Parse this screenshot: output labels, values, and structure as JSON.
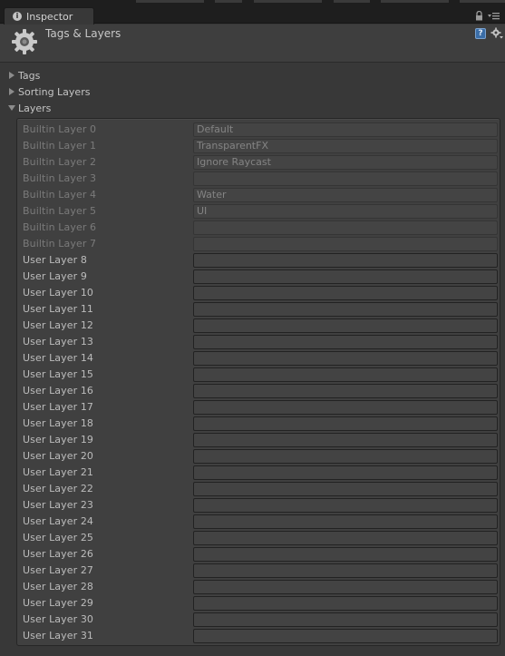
{
  "tab": {
    "label": "Inspector"
  },
  "header": {
    "title": "Tags & Layers"
  },
  "sections": [
    {
      "label": "Tags",
      "expanded": false
    },
    {
      "label": "Sorting Layers",
      "expanded": false
    },
    {
      "label": "Layers",
      "expanded": true
    }
  ],
  "layers": [
    {
      "label": "Builtin Layer 0",
      "value": "Default",
      "builtin": true
    },
    {
      "label": "Builtin Layer 1",
      "value": "TransparentFX",
      "builtin": true
    },
    {
      "label": "Builtin Layer 2",
      "value": "Ignore Raycast",
      "builtin": true
    },
    {
      "label": "Builtin Layer 3",
      "value": "",
      "builtin": true
    },
    {
      "label": "Builtin Layer 4",
      "value": "Water",
      "builtin": true
    },
    {
      "label": "Builtin Layer 5",
      "value": "UI",
      "builtin": true
    },
    {
      "label": "Builtin Layer 6",
      "value": "",
      "builtin": true
    },
    {
      "label": "Builtin Layer 7",
      "value": "",
      "builtin": true
    },
    {
      "label": "User Layer 8",
      "value": "",
      "builtin": false
    },
    {
      "label": "User Layer 9",
      "value": "",
      "builtin": false
    },
    {
      "label": "User Layer 10",
      "value": "",
      "builtin": false
    },
    {
      "label": "User Layer 11",
      "value": "",
      "builtin": false
    },
    {
      "label": "User Layer 12",
      "value": "",
      "builtin": false
    },
    {
      "label": "User Layer 13",
      "value": "",
      "builtin": false
    },
    {
      "label": "User Layer 14",
      "value": "",
      "builtin": false
    },
    {
      "label": "User Layer 15",
      "value": "",
      "builtin": false
    },
    {
      "label": "User Layer 16",
      "value": "",
      "builtin": false
    },
    {
      "label": "User Layer 17",
      "value": "",
      "builtin": false
    },
    {
      "label": "User Layer 18",
      "value": "",
      "builtin": false
    },
    {
      "label": "User Layer 19",
      "value": "",
      "builtin": false
    },
    {
      "label": "User Layer 20",
      "value": "",
      "builtin": false
    },
    {
      "label": "User Layer 21",
      "value": "",
      "builtin": false
    },
    {
      "label": "User Layer 22",
      "value": "",
      "builtin": false
    },
    {
      "label": "User Layer 23",
      "value": "",
      "builtin": false
    },
    {
      "label": "User Layer 24",
      "value": "",
      "builtin": false
    },
    {
      "label": "User Layer 25",
      "value": "",
      "builtin": false
    },
    {
      "label": "User Layer 26",
      "value": "",
      "builtin": false
    },
    {
      "label": "User Layer 27",
      "value": "",
      "builtin": false
    },
    {
      "label": "User Layer 28",
      "value": "",
      "builtin": false
    },
    {
      "label": "User Layer 29",
      "value": "",
      "builtin": false
    },
    {
      "label": "User Layer 30",
      "value": "",
      "builtin": false
    },
    {
      "label": "User Layer 31",
      "value": "",
      "builtin": false
    }
  ],
  "icons": {
    "tab": "info-icon",
    "lock": "lock-icon",
    "menu": "context-menu-icon",
    "header": "gear-icon",
    "help": "help-icon",
    "settings": "settings-icon"
  },
  "colors": {
    "background": "#383838",
    "panel": "#404040",
    "help_accent": "#3b6ea8"
  }
}
